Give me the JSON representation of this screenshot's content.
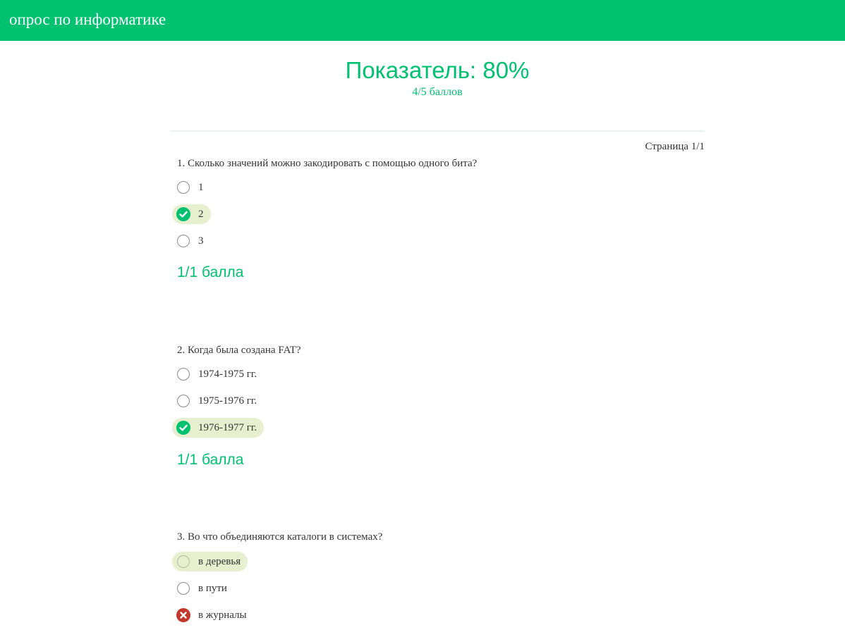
{
  "header": {
    "title": "опрос по информатике"
  },
  "result": {
    "score_label": "Показатель: 80%",
    "points_label": "4/5 баллов"
  },
  "pagination": {
    "label": "Страница 1/1"
  },
  "colors": {
    "accent": "#00c170",
    "highlight": "#e8efcf",
    "wrong": "#c0392b"
  },
  "questions": [
    {
      "text": "1. Сколько значений можно закодировать с помощью одного бита?",
      "options": [
        {
          "label": "1",
          "state": "unselected"
        },
        {
          "label": "2",
          "state": "correct-selected"
        },
        {
          "label": "3",
          "state": "unselected"
        }
      ],
      "points": "1/1 балла"
    },
    {
      "text": "2. Когда была создана FAT?",
      "options": [
        {
          "label": "1974-1975 гг.",
          "state": "unselected"
        },
        {
          "label": "1975-1976 гг.",
          "state": "unselected"
        },
        {
          "label": "1976-1977 гг.",
          "state": "correct-selected"
        }
      ],
      "points": "1/1 балла"
    },
    {
      "text": "3. Во что объединяются каталоги в системах?",
      "options": [
        {
          "label": "в деревья",
          "state": "correct-answer"
        },
        {
          "label": "в пути",
          "state": "unselected"
        },
        {
          "label": "в журналы",
          "state": "wrong-selected"
        }
      ]
    }
  ]
}
